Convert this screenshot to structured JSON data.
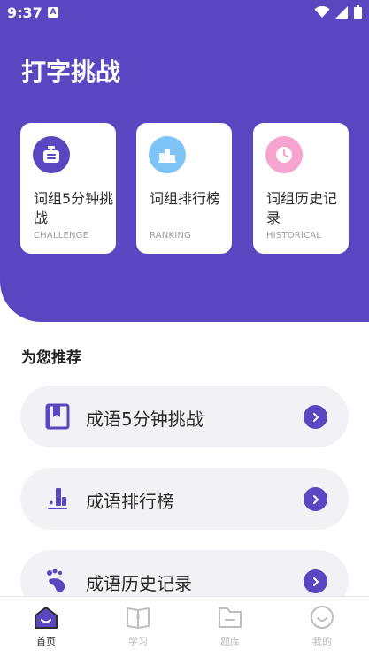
{
  "status": {
    "time": "9:37",
    "badge": "A"
  },
  "page": {
    "title": "打字挑战"
  },
  "cards": [
    {
      "title": "词组5分钟挑战",
      "subtitle": "CHALLENGE",
      "icon": "timer-icon",
      "color": "#5a46c0"
    },
    {
      "title": "词组排行榜",
      "subtitle": "RANKING",
      "icon": "podium-icon",
      "color": "#7fc4f7"
    },
    {
      "title": "词组历史记录",
      "subtitle": "HISTORICAL",
      "icon": "clock-icon",
      "color": "#f7a3cf"
    }
  ],
  "section": {
    "title": "为您推荐"
  },
  "recommendations": [
    {
      "label": "成语5分钟挑战",
      "icon": "bookmark-book-icon"
    },
    {
      "label": "成语排行榜",
      "icon": "bar-chart-icon"
    },
    {
      "label": "成语历史记录",
      "icon": "footprint-icon"
    }
  ],
  "nav": [
    {
      "label": "首页",
      "icon": "home-icon",
      "active": true
    },
    {
      "label": "学习",
      "icon": "book-icon",
      "active": false
    },
    {
      "label": "题库",
      "icon": "folder-icon",
      "active": false
    },
    {
      "label": "我的",
      "icon": "smile-face-icon",
      "active": false
    }
  ],
  "colors": {
    "primary": "#5a46c0",
    "card_bg": "#ffffff",
    "list_bg": "#f2f2f6"
  }
}
